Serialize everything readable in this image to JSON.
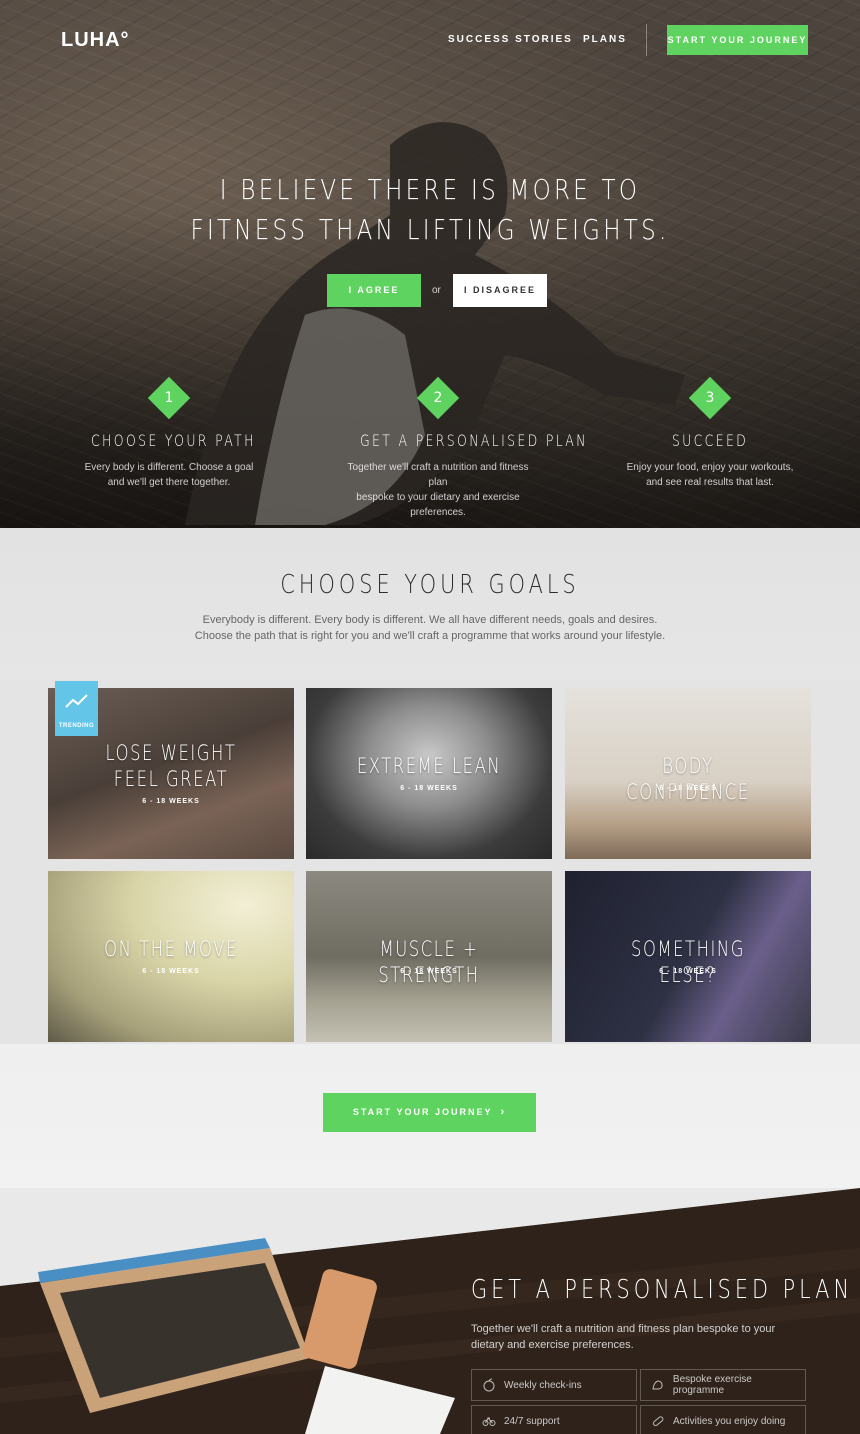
{
  "nav": {
    "logo": "LUHA°",
    "links": [
      "SUCCESS STORIES",
      "PLANS"
    ],
    "cta": "START YOUR JOURNEY"
  },
  "hero": {
    "title_line1": "I BELIEVE THERE IS MORE TO",
    "title_line2": "FITNESS THAN LIFTING WEIGHTS.",
    "agree": "I AGREE",
    "or": "or",
    "disagree": "I DISAGREE",
    "steps": [
      {
        "number": "1",
        "title": "CHOOSE YOUR PATH",
        "desc1": "Every body is different. Choose a goal",
        "desc2": "and we'll get there together."
      },
      {
        "number": "2",
        "title": "GET A PERSONALISED PLAN",
        "desc1": "Together we'll craft a nutrition and fitness plan",
        "desc2": "bespoke to your dietary and exercise preferences."
      },
      {
        "number": "3",
        "title": "SUCCEED",
        "desc1": "Enjoy your food, enjoy your workouts,",
        "desc2": "and see real results that last."
      }
    ]
  },
  "goals": {
    "title": "CHOOSE YOUR GOALS",
    "sub1": "Everybody is different. Every body is different. We all have different needs, goals and desires.",
    "sub2": "Choose the path that is right for you and we'll craft a programme that works around your lifestyle.",
    "trending": "TRENDING",
    "tiles": [
      {
        "title": "LOSE WEIGHT FEEL GREAT",
        "weeks": "6 - 18 WEEKS"
      },
      {
        "title": "EXTREME LEAN",
        "weeks": "6 - 18 WEEKS"
      },
      {
        "title": "BODY CONFIDENCE",
        "weeks": "6 - 18 WEEKS"
      },
      {
        "title": "ON THE MOVE",
        "weeks": "6 - 18 WEEKS"
      },
      {
        "title": "MUSCLE + STRENGTH",
        "weeks": "6 - 18 WEEKS"
      },
      {
        "title": "SOMETHING ELSE?",
        "weeks": "6 - 18 WEEKS"
      }
    ],
    "cta": "START YOUR JOURNEY"
  },
  "plan": {
    "title": "GET A PERSONALISED PLAN",
    "desc": "Together we'll craft a nutrition and fitness plan bespoke to your dietary and exercise preferences.",
    "features": [
      "Weekly check-ins",
      "Bespoke exercise programme",
      "24/7 support",
      "Activities you enjoy doing"
    ]
  },
  "colors": {
    "accent": "#5fd35f",
    "trending": "#63c5e8"
  }
}
